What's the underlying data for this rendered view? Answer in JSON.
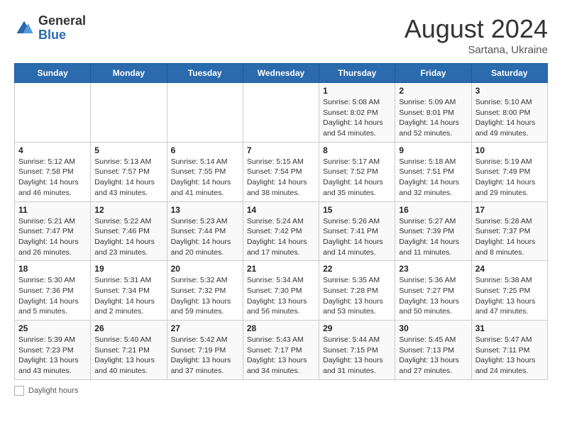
{
  "header": {
    "logo_general": "General",
    "logo_blue": "Blue",
    "month_title": "August 2024",
    "location": "Sartana, Ukraine"
  },
  "days_of_week": [
    "Sunday",
    "Monday",
    "Tuesday",
    "Wednesday",
    "Thursday",
    "Friday",
    "Saturday"
  ],
  "footer": {
    "label": "Daylight hours"
  },
  "weeks": [
    [
      {
        "day": "",
        "info": ""
      },
      {
        "day": "",
        "info": ""
      },
      {
        "day": "",
        "info": ""
      },
      {
        "day": "",
        "info": ""
      },
      {
        "day": "1",
        "info": "Sunrise: 5:08 AM\nSunset: 8:02 PM\nDaylight: 14 hours and 54 minutes."
      },
      {
        "day": "2",
        "info": "Sunrise: 5:09 AM\nSunset: 8:01 PM\nDaylight: 14 hours and 52 minutes."
      },
      {
        "day": "3",
        "info": "Sunrise: 5:10 AM\nSunset: 8:00 PM\nDaylight: 14 hours and 49 minutes."
      }
    ],
    [
      {
        "day": "4",
        "info": "Sunrise: 5:12 AM\nSunset: 7:58 PM\nDaylight: 14 hours and 46 minutes."
      },
      {
        "day": "5",
        "info": "Sunrise: 5:13 AM\nSunset: 7:57 PM\nDaylight: 14 hours and 43 minutes."
      },
      {
        "day": "6",
        "info": "Sunrise: 5:14 AM\nSunset: 7:55 PM\nDaylight: 14 hours and 41 minutes."
      },
      {
        "day": "7",
        "info": "Sunrise: 5:15 AM\nSunset: 7:54 PM\nDaylight: 14 hours and 38 minutes."
      },
      {
        "day": "8",
        "info": "Sunrise: 5:17 AM\nSunset: 7:52 PM\nDaylight: 14 hours and 35 minutes."
      },
      {
        "day": "9",
        "info": "Sunrise: 5:18 AM\nSunset: 7:51 PM\nDaylight: 14 hours and 32 minutes."
      },
      {
        "day": "10",
        "info": "Sunrise: 5:19 AM\nSunset: 7:49 PM\nDaylight: 14 hours and 29 minutes."
      }
    ],
    [
      {
        "day": "11",
        "info": "Sunrise: 5:21 AM\nSunset: 7:47 PM\nDaylight: 14 hours and 26 minutes."
      },
      {
        "day": "12",
        "info": "Sunrise: 5:22 AM\nSunset: 7:46 PM\nDaylight: 14 hours and 23 minutes."
      },
      {
        "day": "13",
        "info": "Sunrise: 5:23 AM\nSunset: 7:44 PM\nDaylight: 14 hours and 20 minutes."
      },
      {
        "day": "14",
        "info": "Sunrise: 5:24 AM\nSunset: 7:42 PM\nDaylight: 14 hours and 17 minutes."
      },
      {
        "day": "15",
        "info": "Sunrise: 5:26 AM\nSunset: 7:41 PM\nDaylight: 14 hours and 14 minutes."
      },
      {
        "day": "16",
        "info": "Sunrise: 5:27 AM\nSunset: 7:39 PM\nDaylight: 14 hours and 11 minutes."
      },
      {
        "day": "17",
        "info": "Sunrise: 5:28 AM\nSunset: 7:37 PM\nDaylight: 14 hours and 8 minutes."
      }
    ],
    [
      {
        "day": "18",
        "info": "Sunrise: 5:30 AM\nSunset: 7:36 PM\nDaylight: 14 hours and 5 minutes."
      },
      {
        "day": "19",
        "info": "Sunrise: 5:31 AM\nSunset: 7:34 PM\nDaylight: 14 hours and 2 minutes."
      },
      {
        "day": "20",
        "info": "Sunrise: 5:32 AM\nSunset: 7:32 PM\nDaylight: 13 hours and 59 minutes."
      },
      {
        "day": "21",
        "info": "Sunrise: 5:34 AM\nSunset: 7:30 PM\nDaylight: 13 hours and 56 minutes."
      },
      {
        "day": "22",
        "info": "Sunrise: 5:35 AM\nSunset: 7:28 PM\nDaylight: 13 hours and 53 minutes."
      },
      {
        "day": "23",
        "info": "Sunrise: 5:36 AM\nSunset: 7:27 PM\nDaylight: 13 hours and 50 minutes."
      },
      {
        "day": "24",
        "info": "Sunrise: 5:38 AM\nSunset: 7:25 PM\nDaylight: 13 hours and 47 minutes."
      }
    ],
    [
      {
        "day": "25",
        "info": "Sunrise: 5:39 AM\nSunset: 7:23 PM\nDaylight: 13 hours and 43 minutes."
      },
      {
        "day": "26",
        "info": "Sunrise: 5:40 AM\nSunset: 7:21 PM\nDaylight: 13 hours and 40 minutes."
      },
      {
        "day": "27",
        "info": "Sunrise: 5:42 AM\nSunset: 7:19 PM\nDaylight: 13 hours and 37 minutes."
      },
      {
        "day": "28",
        "info": "Sunrise: 5:43 AM\nSunset: 7:17 PM\nDaylight: 13 hours and 34 minutes."
      },
      {
        "day": "29",
        "info": "Sunrise: 5:44 AM\nSunset: 7:15 PM\nDaylight: 13 hours and 31 minutes."
      },
      {
        "day": "30",
        "info": "Sunrise: 5:45 AM\nSunset: 7:13 PM\nDaylight: 13 hours and 27 minutes."
      },
      {
        "day": "31",
        "info": "Sunrise: 5:47 AM\nSunset: 7:11 PM\nDaylight: 13 hours and 24 minutes."
      }
    ]
  ]
}
